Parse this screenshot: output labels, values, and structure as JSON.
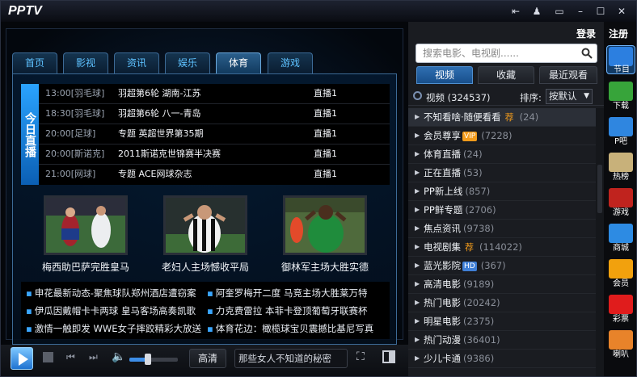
{
  "app": {
    "logo": "PPTV"
  },
  "titlebar": {
    "icons": [
      "pin-icon",
      "skin-icon",
      "mini-icon",
      "minimize-icon",
      "maximize-icon",
      "close-icon"
    ],
    "glyphs": [
      "⇤",
      "♟",
      "▭",
      "–",
      "☐",
      "✕"
    ]
  },
  "tabs": [
    {
      "label": "首页"
    },
    {
      "label": "影视"
    },
    {
      "label": "资讯"
    },
    {
      "label": "娱乐"
    },
    {
      "label": "体育"
    },
    {
      "label": "游戏"
    }
  ],
  "active_tab": "体育",
  "schedule": {
    "today_label": "今日直播",
    "rows": [
      {
        "time": "13:00[羽毛球]",
        "match": "羽超第6轮 湖南-江苏",
        "status": "直播1"
      },
      {
        "time": "18:30[羽毛球]",
        "match": "羽超第6轮 八一-青岛",
        "status": "直播1"
      },
      {
        "time": "20:00[足球]",
        "match": "专题 英超世界第35期",
        "status": "直播1"
      },
      {
        "time": "20:00[斯诺克]",
        "match": "2011斯诺克世锦赛半决赛",
        "status": "直播1"
      },
      {
        "time": "21:00[网球]",
        "match": "专题 ACE网球杂志",
        "status": "直播1"
      }
    ]
  },
  "thumbs": [
    {
      "caption": "梅西助巴萨完胜皇马"
    },
    {
      "caption": "老妇人主场憾收平局"
    },
    {
      "caption": "御林军主场大胜实德"
    }
  ],
  "news": [
    {
      "text": "申花最新动态-聚焦球队郑州酒店遭窃案"
    },
    {
      "text": "阿奎罗梅开二度 马竞主场大胜莱万特"
    },
    {
      "text": "伊瓜因戴帽卡卡两球 皇马客场高奏凯歌"
    },
    {
      "text": "力克费雷拉 本菲卡登顶葡萄牙联赛杯"
    },
    {
      "text": "激情一触即发 WWE女子摔跤精彩大放送"
    },
    {
      "text": "体育花边：橄榄球宝贝震撼比基尼写真"
    }
  ],
  "controls": {
    "quality_label": "高清",
    "now_playing": "那些女人不知道的秘密"
  },
  "volume": {
    "level": 0.38
  },
  "right": {
    "login_label": "登录",
    "search_placeholder": "搜索电影、电视剧......",
    "tabs": [
      "视频",
      "收藏",
      "最近观看"
    ],
    "filter_label": "视频 (324537)",
    "sort_label": "排序:",
    "sort_value": "按默认",
    "items": [
      {
        "name": "不知看啥·随便看看",
        "badge": "荐",
        "count": "(24)"
      },
      {
        "name": "会员尊享",
        "badge": "VIP",
        "count": "(7228)"
      },
      {
        "name": "体育直播",
        "badge": "",
        "count": "(24)"
      },
      {
        "name": "正在直播",
        "badge": "",
        "count": "(53)"
      },
      {
        "name": "PP新上线",
        "badge": "",
        "count": "(857)"
      },
      {
        "name": "PP鲜专题",
        "badge": "",
        "count": "(2706)"
      },
      {
        "name": "焦点资讯",
        "badge": "",
        "count": "(9738)"
      },
      {
        "name": "电视剧集",
        "badge": "荐",
        "count": "(114022)"
      },
      {
        "name": "蓝光影院",
        "badge": "HD",
        "count": "(367)"
      },
      {
        "name": "高清电影",
        "badge": "",
        "count": "(9189)"
      },
      {
        "name": "热门电影",
        "badge": "",
        "count": "(20242)"
      },
      {
        "name": "明星电影",
        "badge": "",
        "count": "(2375)"
      },
      {
        "name": "热门动漫",
        "badge": "",
        "count": "(36401)"
      },
      {
        "name": "少儿卡通",
        "badge": "",
        "count": "(9386)"
      }
    ]
  },
  "sidebar": {
    "register_label": "注册",
    "buttons": [
      {
        "label": "节目",
        "icon": "play-program-icon",
        "color": "#2c7fe0"
      },
      {
        "label": "下载",
        "icon": "download-icon",
        "color": "#37a43a"
      },
      {
        "label": "P吧",
        "icon": "pbar-icon",
        "color": "#2f86e0"
      },
      {
        "label": "热榜",
        "icon": "hot-chart-icon",
        "color": "#c8b17a"
      },
      {
        "label": "游戏",
        "icon": "game-icon",
        "color": "#c0231e"
      },
      {
        "label": "商城",
        "icon": "mall-icon",
        "color": "#2d8be3"
      },
      {
        "label": "会员",
        "icon": "vip-icon",
        "color": "#f2a10d"
      },
      {
        "label": "彩票",
        "icon": "lottery-icon",
        "color": "#e01c1c"
      },
      {
        "label": "喇叭",
        "icon": "speaker-icon",
        "color": "#e8832a"
      }
    ]
  },
  "colors": {
    "accent": "#2f86e0",
    "tab_text": "#5ec2ff",
    "badge_orange": "#f29b1b",
    "badge_hd": "#3f7fd6"
  }
}
